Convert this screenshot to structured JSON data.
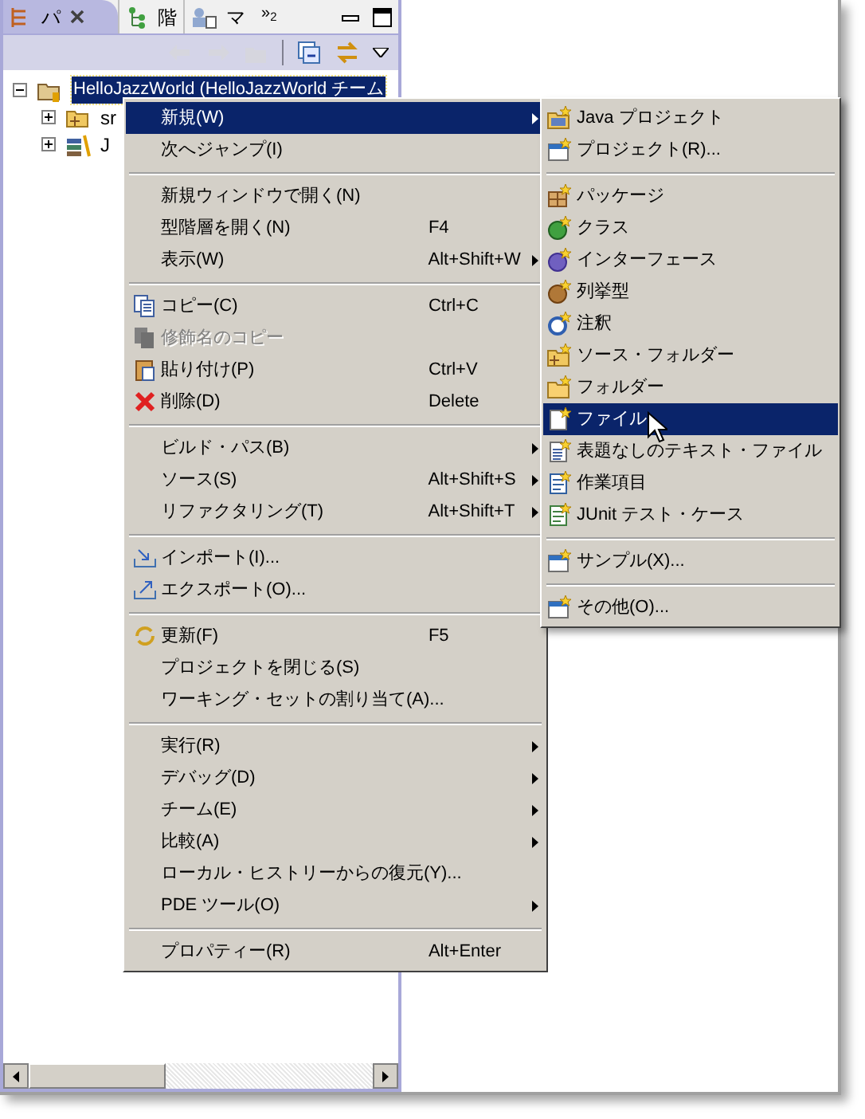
{
  "view": {
    "tabs": [
      {
        "label": "パ",
        "selected": true
      },
      {
        "label": "階",
        "selected": false
      },
      {
        "label": "マ",
        "selected": false
      }
    ],
    "overflow": "»$_{2}$",
    "toolbar": [
      {
        "disabled": true
      },
      {
        "disabled": true
      },
      {
        "disabled": true
      },
      {
        "disabled": false
      },
      {
        "disabled": false
      }
    ],
    "tree": [
      {
        "label": "HelloJazzWorld (HelloJazzWorld チーム",
        "expanded": true,
        "selected": true,
        "children": [
          {
            "label": "sr",
            "expanded": false,
            "selected": false
          },
          {
            "label": "J",
            "expanded": false,
            "selected": false
          }
        ]
      }
    ]
  },
  "context_menu": {
    "items": [
      {
        "kind": "item",
        "label": "新規(W)",
        "submenu": true,
        "selected": true,
        "disabled": false
      },
      {
        "kind": "item",
        "label": "次へジャンプ(I)",
        "submenu": false,
        "selected": false,
        "disabled": false
      },
      {
        "kind": "separator"
      },
      {
        "kind": "item",
        "label": "新規ウィンドウで開く(N)",
        "submenu": false,
        "selected": false,
        "disabled": false
      },
      {
        "kind": "item",
        "label": "型階層を開く(N)",
        "shortcut": "F4",
        "submenu": false,
        "selected": false,
        "disabled": false
      },
      {
        "kind": "item",
        "label": "表示(W)",
        "shortcut": "Alt+Shift+W",
        "submenu": true,
        "selected": false,
        "disabled": false
      },
      {
        "kind": "separator"
      },
      {
        "kind": "item",
        "label": "コピー(C)",
        "shortcut": "Ctrl+C",
        "submenu": false,
        "selected": false,
        "disabled": false
      },
      {
        "kind": "item",
        "label": "修飾名のコピー",
        "submenu": false,
        "selected": false,
        "disabled": true
      },
      {
        "kind": "item",
        "label": "貼り付け(P)",
        "shortcut": "Ctrl+V",
        "submenu": false,
        "selected": false,
        "disabled": false
      },
      {
        "kind": "item",
        "label": "削除(D)",
        "shortcut": "Delete",
        "submenu": false,
        "selected": false,
        "disabled": false
      },
      {
        "kind": "separator"
      },
      {
        "kind": "item",
        "label": "ビルド・パス(B)",
        "submenu": true,
        "selected": false,
        "disabled": false
      },
      {
        "kind": "item",
        "label": "ソース(S)",
        "shortcut": "Alt+Shift+S",
        "submenu": true,
        "selected": false,
        "disabled": false
      },
      {
        "kind": "item",
        "label": "リファクタリング(T)",
        "shortcut": "Alt+Shift+T",
        "submenu": true,
        "selected": false,
        "disabled": false
      },
      {
        "kind": "separator"
      },
      {
        "kind": "item",
        "label": "インポート(I)...",
        "submenu": false,
        "selected": false,
        "disabled": false
      },
      {
        "kind": "item",
        "label": "エクスポート(O)...",
        "submenu": false,
        "selected": false,
        "disabled": false
      },
      {
        "kind": "separator"
      },
      {
        "kind": "item",
        "label": "更新(F)",
        "shortcut": "F5",
        "submenu": false,
        "selected": false,
        "disabled": false
      },
      {
        "kind": "item",
        "label": "プロジェクトを閉じる(S)",
        "submenu": false,
        "selected": false,
        "disabled": false
      },
      {
        "kind": "item",
        "label": "ワーキング・セットの割り当て(A)...",
        "submenu": false,
        "selected": false,
        "disabled": false
      },
      {
        "kind": "separator"
      },
      {
        "kind": "item",
        "label": "実行(R)",
        "submenu": true,
        "selected": false,
        "disabled": false
      },
      {
        "kind": "item",
        "label": "デバッグ(D)",
        "submenu": true,
        "selected": false,
        "disabled": false
      },
      {
        "kind": "item",
        "label": "チーム(E)",
        "submenu": true,
        "selected": false,
        "disabled": false
      },
      {
        "kind": "item",
        "label": "比較(A)",
        "submenu": true,
        "selected": false,
        "disabled": false
      },
      {
        "kind": "item",
        "label": "ローカル・ヒストリーからの復元(Y)...",
        "submenu": false,
        "selected": false,
        "disabled": false
      },
      {
        "kind": "item",
        "label": "PDE ツール(O)",
        "submenu": true,
        "selected": false,
        "disabled": false
      },
      {
        "kind": "separator"
      },
      {
        "kind": "item",
        "label": "プロパティー(R)",
        "shortcut": "Alt+Enter",
        "submenu": false,
        "selected": false,
        "disabled": false
      }
    ]
  },
  "submenu": {
    "items": [
      {
        "kind": "item",
        "label": "Java プロジェクト",
        "selected": false
      },
      {
        "kind": "item",
        "label": "プロジェクト(R)...",
        "selected": false
      },
      {
        "kind": "separator"
      },
      {
        "kind": "item",
        "label": "パッケージ",
        "selected": false
      },
      {
        "kind": "item",
        "label": "クラス",
        "selected": false
      },
      {
        "kind": "item",
        "label": "インターフェース",
        "selected": false
      },
      {
        "kind": "item",
        "label": "列挙型",
        "selected": false
      },
      {
        "kind": "item",
        "label": "注釈",
        "selected": false
      },
      {
        "kind": "item",
        "label": "ソース・フォルダー",
        "selected": false
      },
      {
        "kind": "item",
        "label": "フォルダー",
        "selected": false
      },
      {
        "kind": "item",
        "label": "ファイル",
        "selected": true
      },
      {
        "kind": "item",
        "label": "表題なしのテキスト・ファイル",
        "selected": false
      },
      {
        "kind": "item",
        "label": "作業項目",
        "selected": false
      },
      {
        "kind": "item",
        "label": "JUnit テスト・ケース",
        "selected": false
      },
      {
        "kind": "separator"
      },
      {
        "kind": "item",
        "label": "サンプル(X)...",
        "selected": false
      },
      {
        "kind": "separator"
      },
      {
        "kind": "item",
        "label": "その他(O)...",
        "selected": false
      }
    ]
  }
}
